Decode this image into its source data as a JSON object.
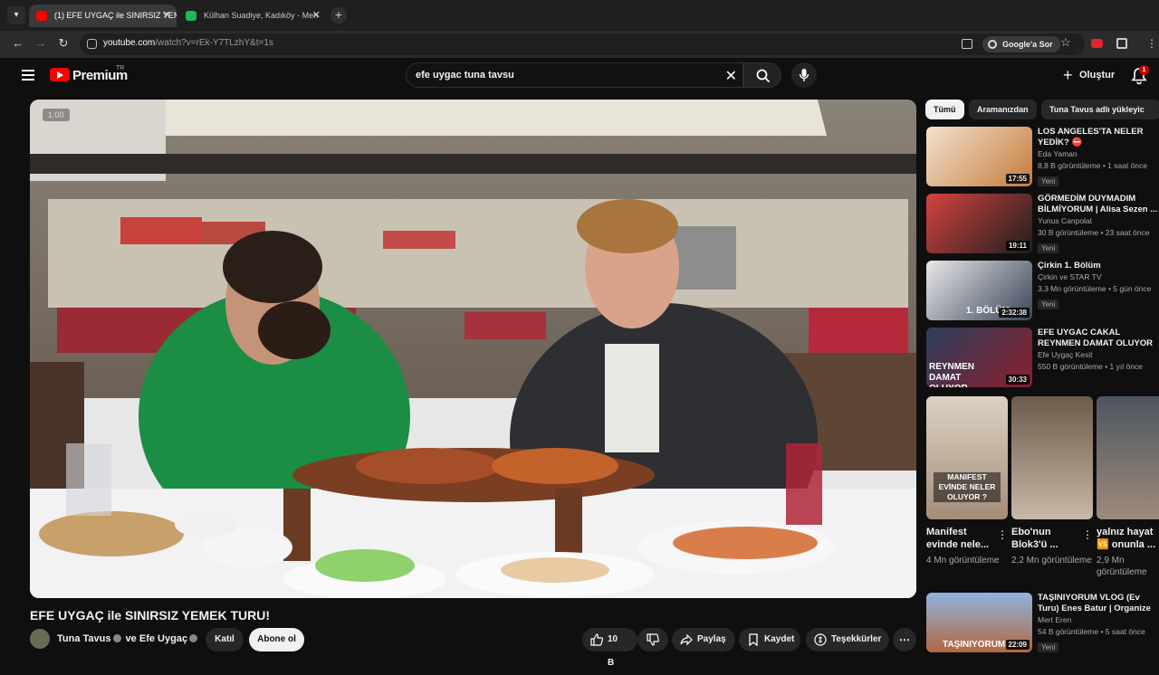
{
  "browser": {
    "tabs": [
      {
        "label": "(1) EFE UYGAÇ ile SINIRSIZ YEME",
        "active": true
      },
      {
        "label": "Külhan Suadiye, Kadıköy - Men",
        "active": false
      }
    ],
    "url_host": "youtube.com",
    "url_path": "/watch?v=rEk-Y7TLzhY&t=1s",
    "google_label": "Google'a Sor"
  },
  "header": {
    "logo_text": "Premium",
    "logo_region": "TR",
    "search_query": "efe uygac tuna tavsu",
    "create_label": "Oluştur",
    "notification_count": "1"
  },
  "player": {
    "timecode": "1:00"
  },
  "video": {
    "title": "EFE UYGAÇ ile SINIRSIZ YEMEK TURU!",
    "channel_1": "Tuna Tavus",
    "channel_join": "ve",
    "channel_2": "Efe Uygaç",
    "join_label": "Katıl",
    "subscribe_label": "Abone ol",
    "likes": "10 B",
    "share_label": "Paylaş",
    "save_label": "Kaydet",
    "thanks_label": "Teşekkürler",
    "more": "⋯"
  },
  "chips": [
    "Tümü",
    "Aramanızdan",
    "Tuna Tavus adlı yükleyic"
  ],
  "recommendations": [
    {
      "title": "LOS ANGELES'TA NELER YEDİK? ⛔",
      "channel": "Eda Yaman",
      "meta": "8,8 B görüntüleme • 1 saat önce",
      "badge": "Yeni",
      "duration": "17:55",
      "thumb_color": "#c9a77e"
    },
    {
      "title": "GÖRMEDİM DUYMADIM BİLMİYORUM | Alisa Sezen ...",
      "channel": "Yunus Canpolat",
      "meta": "30 B görüntüleme • 23 saat önce",
      "badge": "Yeni",
      "duration": "19:11",
      "thumb_color": "#b83c3c"
    },
    {
      "title": "Çirkin 1. Bölüm",
      "channel": "Çirkin ve STAR TV",
      "meta": "3,3 Mn görüntüleme • 5 gün önce",
      "badge": "Yeni",
      "duration": "2:32:38",
      "thumb_color": "#3b4556"
    },
    {
      "title": "EFE UYGAC CAKAL REYNMEN DAMAT OLUYOR SIRA DA BİZE",
      "channel": "Efe Uygaç Kesit",
      "meta": "550 B görüntüleme • 1 yıl önce",
      "badge": "",
      "duration": "30:33",
      "thumb_color": "#26354f"
    },
    {
      "title": "TAŞINIYORUM VLOG (Ev Turu) Enes Batur | Organize",
      "channel": "Mert Eren",
      "meta": "54 B görüntüleme • 5 saat önce",
      "badge": "Yeni",
      "duration": "22:09",
      "thumb_color": "#8fa7c8"
    }
  ],
  "shorts": [
    {
      "title": "Manifest evinde nele...",
      "views": "4 Mn görüntüleme",
      "thumb_color": "#c8b9a8"
    },
    {
      "title": "Ebo'nun Blok3'ü ...",
      "views": "2,2 Mn görüntüleme",
      "thumb_color": "#8a7a6a"
    },
    {
      "title": "yalnız hayat 🆚 onunla ...",
      "views": "2,9 Mn görüntüleme",
      "thumb_color": "#5c5d60"
    }
  ],
  "short_overlay": "MANIFEST EVİNDE NELER OLUYOR ?",
  "thumb_captions": [
    "1. BÖLÜM",
    "REYNMEN DAMAT OLUYOR",
    "TAŞINIYORUM"
  ]
}
